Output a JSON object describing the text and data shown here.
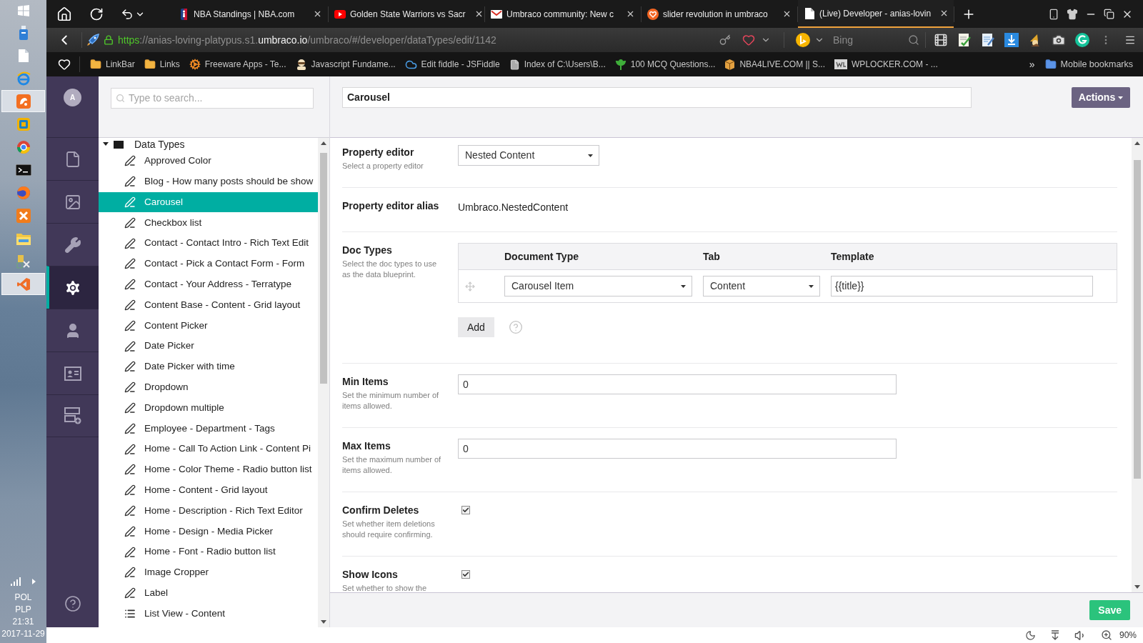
{
  "taskbar": {
    "apps": [
      {
        "active": false
      },
      {
        "active": false
      },
      {
        "active": false
      },
      {
        "active": true
      },
      {
        "active": false
      },
      {
        "active": false
      },
      {
        "active": false
      },
      {
        "active": false
      },
      {
        "active": false
      },
      {
        "active": false
      },
      {
        "active": false
      },
      {
        "active": true
      }
    ],
    "tray": {
      "language": "POL",
      "layout": "PLP",
      "time": "21:31",
      "date": "2017-11-29"
    }
  },
  "browser": {
    "tabs": [
      {
        "title": "NBA Standings | NBA.com",
        "selected": false
      },
      {
        "title": "Golden State Warriors vs Sacr",
        "selected": false
      },
      {
        "title": "Umbraco community: New c",
        "selected": false
      },
      {
        "title": "slider revolution in umbraco",
        "selected": false
      },
      {
        "title": "(Live) Developer - anias-lovin",
        "selected": true
      }
    ],
    "address": [
      {
        "kind": "scheme",
        "text": "https"
      },
      {
        "kind": "plain",
        "text": "://anias-loving-platypus.s1."
      },
      {
        "kind": "domain",
        "text": "umbraco.io"
      },
      {
        "kind": "plain",
        "text": "/umbraco/#/developer/dataTypes/edit/1142"
      }
    ],
    "search": {
      "placeholder": "Bing"
    },
    "bookmarks": [
      {
        "kind": "folder",
        "label": "LinkBar"
      },
      {
        "kind": "folder",
        "label": "Links"
      },
      {
        "kind": "page",
        "label": "Freeware Apps - Te..."
      },
      {
        "kind": "page",
        "label": "Javascript Fundame..."
      },
      {
        "kind": "page",
        "label": "Edit fiddle - JSFiddle"
      },
      {
        "kind": "page",
        "label": "Index of C:\\Users\\B..."
      },
      {
        "kind": "page",
        "label": "100 MCQ Questions..."
      },
      {
        "kind": "page",
        "label": "NBA4LIVE.COM || S..."
      },
      {
        "kind": "page",
        "label": "WPLOCKER.COM - ..."
      }
    ],
    "overflow": "»",
    "mobile_bookmarks": "Mobile bookmarks"
  },
  "umbraco": {
    "avatar": "A",
    "sections": [
      {
        "selected": false
      },
      {
        "selected": false
      },
      {
        "selected": false
      },
      {
        "selected": true
      },
      {
        "selected": false
      },
      {
        "selected": false
      },
      {
        "selected": false
      }
    ],
    "tree": {
      "search_placeholder": "Type to search...",
      "root": {
        "label": "Data Types",
        "expanded": true,
        "children": [
          {
            "label": "Approved Color",
            "kind": "datatype",
            "selected": false
          },
          {
            "label": "Blog - How many posts should be show",
            "kind": "datatype",
            "selected": false
          },
          {
            "label": "Carousel",
            "kind": "datatype",
            "selected": true
          },
          {
            "label": "Checkbox list",
            "kind": "datatype",
            "selected": false
          },
          {
            "label": "Contact - Contact Intro - Rich Text Edit",
            "kind": "datatype",
            "selected": false
          },
          {
            "label": "Contact - Pick a Contact Form - Form",
            "kind": "datatype",
            "selected": false
          },
          {
            "label": "Contact - Your Address - Terratype",
            "kind": "datatype",
            "selected": false
          },
          {
            "label": "Content Base - Content - Grid layout",
            "kind": "datatype",
            "selected": false
          },
          {
            "label": "Content Picker",
            "kind": "datatype",
            "selected": false
          },
          {
            "label": "Date Picker",
            "kind": "datatype",
            "selected": false
          },
          {
            "label": "Date Picker with time",
            "kind": "datatype",
            "selected": false
          },
          {
            "label": "Dropdown",
            "kind": "datatype",
            "selected": false
          },
          {
            "label": "Dropdown multiple",
            "kind": "datatype",
            "selected": false
          },
          {
            "label": "Employee - Department - Tags",
            "kind": "datatype",
            "selected": false
          },
          {
            "label": "Home - Call To Action Link - Content Pi",
            "kind": "datatype",
            "selected": false
          },
          {
            "label": "Home - Color Theme - Radio button list",
            "kind": "datatype",
            "selected": false
          },
          {
            "label": "Home - Content - Grid layout",
            "kind": "datatype",
            "selected": false
          },
          {
            "label": "Home - Description - Rich Text Editor",
            "kind": "datatype",
            "selected": false
          },
          {
            "label": "Home - Design - Media Picker",
            "kind": "datatype",
            "selected": false
          },
          {
            "label": "Home - Font - Radio button list",
            "kind": "datatype",
            "selected": false
          },
          {
            "label": "Image Cropper",
            "kind": "datatype",
            "selected": false
          },
          {
            "label": "Label",
            "kind": "datatype",
            "selected": false
          },
          {
            "label": "List View - Content",
            "kind": "listview",
            "selected": false
          }
        ]
      }
    },
    "editor": {
      "name": "Carousel",
      "actions": "Actions",
      "properties": [
        {
          "kind": "select",
          "label": "Property editor",
          "description": "Select a property editor",
          "value": "Nested Content"
        },
        {
          "kind": "text",
          "label": "Property editor alias",
          "value": "Umbraco.NestedContent"
        },
        {
          "kind": "doctypes",
          "label": "Doc Types",
          "description": "Select the doc types to use as the data blueprint.",
          "columns": [
            "Document Type",
            "Tab",
            "Template"
          ],
          "rows": [
            {
              "document_type": "Carousel Item",
              "tab": "Content",
              "template": "{{title}}"
            }
          ],
          "add": "Add"
        },
        {
          "kind": "number",
          "label": "Min Items",
          "description": "Set the minimum number of items allowed.",
          "value": "0"
        },
        {
          "kind": "number",
          "label": "Max Items",
          "description": "Set the maximum number of items allowed.",
          "value": "0"
        },
        {
          "kind": "checkbox",
          "label": "Confirm Deletes",
          "description": "Set whether item deletions should require confirming.",
          "checked": true
        },
        {
          "kind": "checkbox",
          "label": "Show Icons",
          "description": "Set whether to show the",
          "checked": true
        }
      ],
      "save": "Save"
    }
  },
  "status_bar": {
    "zoom": "90%"
  }
}
